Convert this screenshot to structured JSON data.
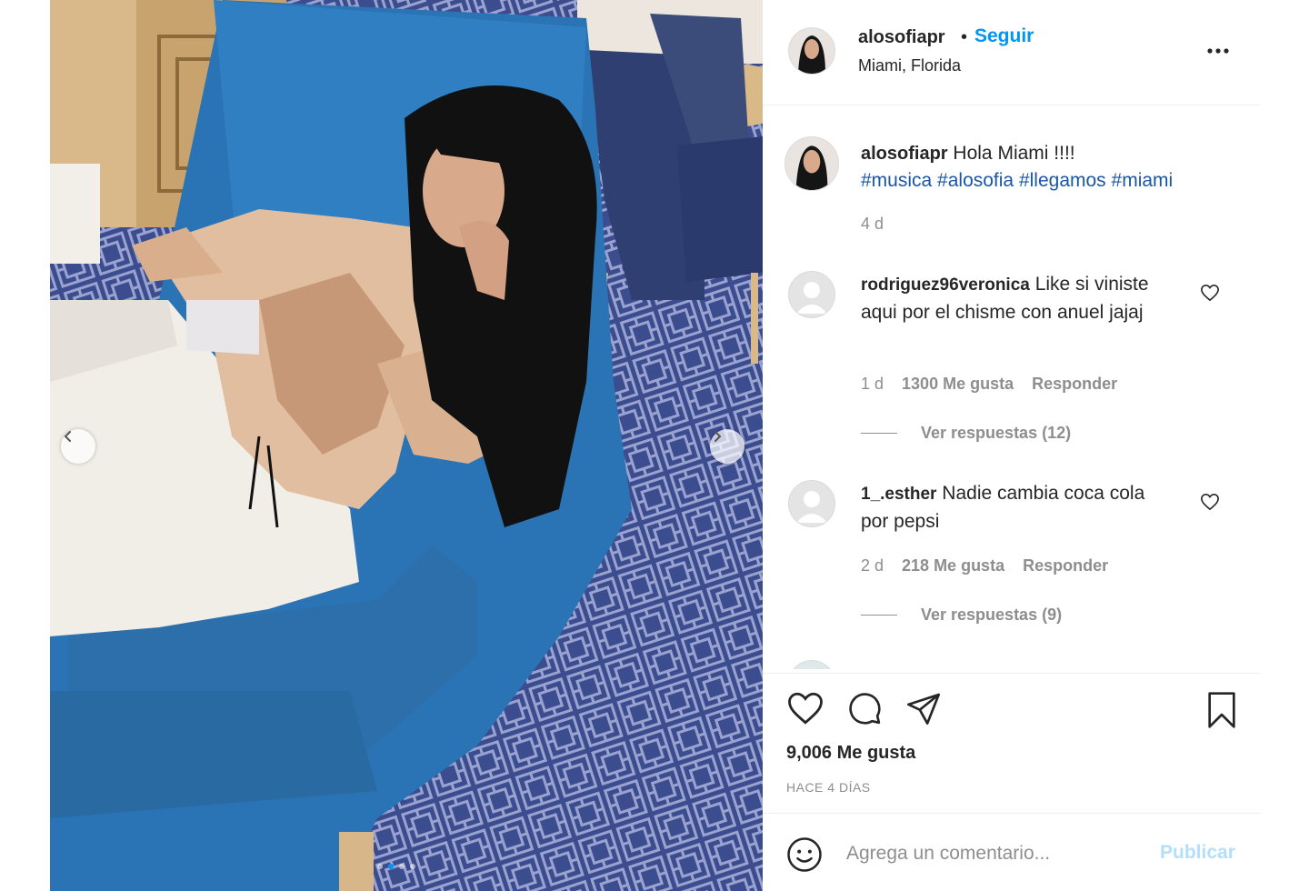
{
  "post": {
    "username": "alosofiapr",
    "separator": "•",
    "follow_label": "Seguir",
    "location": "Miami, Florida",
    "more_icon": "more-options-icon"
  },
  "caption": {
    "username": "alosofiapr",
    "text": "Hola Miami !!!!",
    "hashtags": [
      "#musica",
      "#alosofia",
      "#llegamos",
      "#miami"
    ],
    "time": "4 d"
  },
  "comments": [
    {
      "username": "rodriguez96veronica",
      "text": "Like si viniste aqui por el chisme con anuel jajaj",
      "time": "1 d",
      "likes": "1300 Me gusta",
      "reply": "Responder",
      "view_replies": "Ver respuestas (12)"
    },
    {
      "username": "1_.esther",
      "text": "Nadie cambia coca cola por pepsi",
      "time": "2 d",
      "likes": "218 Me gusta",
      "reply": "Responder",
      "view_replies": "Ver respuestas (9)"
    }
  ],
  "stats": {
    "likes": "9,006 Me gusta",
    "date": "HACE 4 DÍAS"
  },
  "composer": {
    "placeholder": "Agrega un comentario...",
    "publish_label": "Publicar"
  },
  "carousel": {
    "current_slide": 2,
    "total_slides": 4
  },
  "colors": {
    "accent": "#0095f6",
    "muted": "#8e8e8e",
    "hashtag": "#1a56a8",
    "publish_disabled": "#b2dffc"
  }
}
